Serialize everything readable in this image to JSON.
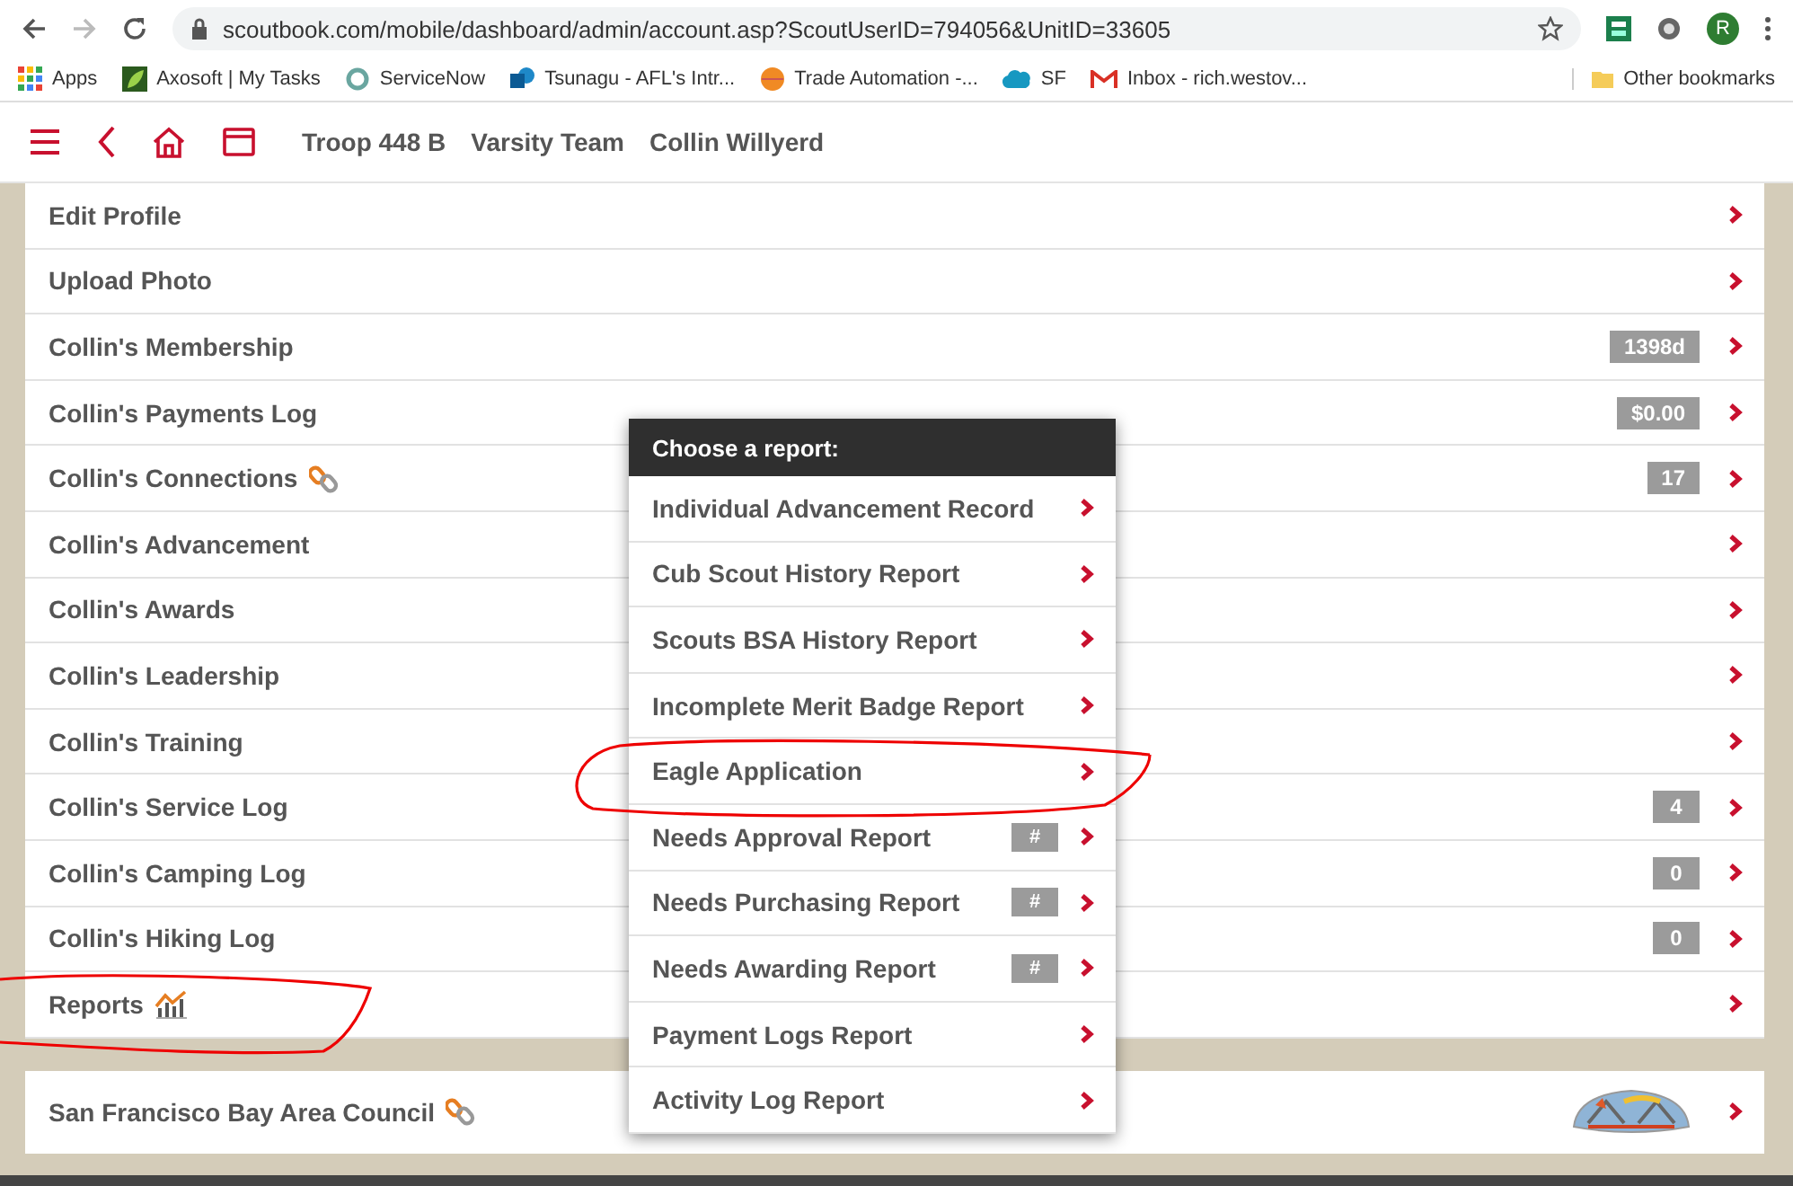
{
  "browser": {
    "url": "scoutbook.com/mobile/dashboard/admin/account.asp?ScoutUserID=794056&UnitID=33605",
    "profile_initial": "R",
    "bookmarks": [
      {
        "label": "Apps",
        "kind": "apps"
      },
      {
        "label": "Axosoft | My Tasks",
        "kind": "leaf"
      },
      {
        "label": "ServiceNow",
        "kind": "ring"
      },
      {
        "label": "Tsunagu - AFL's Intr...",
        "kind": "share"
      },
      {
        "label": "Trade Automation -...",
        "kind": "ball"
      },
      {
        "label": "SF",
        "kind": "cloud"
      },
      {
        "label": "Inbox - rich.westov...",
        "kind": "mail"
      }
    ],
    "other_bookmarks": "Other bookmarks"
  },
  "header": {
    "crumbs": [
      "Troop 448 B",
      "Varsity Team",
      "Collin Willyerd"
    ]
  },
  "menu": [
    {
      "label": "Edit Profile",
      "kind": "plain"
    },
    {
      "label": "Upload Photo",
      "kind": "plain"
    },
    {
      "label": "Collin's Membership",
      "kind": "plain",
      "badge": "1398d"
    },
    {
      "label": "Collin's Payments Log",
      "kind": "plain",
      "badge": "$0.00"
    },
    {
      "label": "Collin's Connections",
      "kind": "link",
      "badge": "17"
    },
    {
      "label": "Collin's Advancement",
      "kind": "plain"
    },
    {
      "label": "Collin's Awards",
      "kind": "plain"
    },
    {
      "label": "Collin's Leadership",
      "kind": "plain"
    },
    {
      "label": "Collin's Training",
      "kind": "plain"
    },
    {
      "label": "Collin's Service Log",
      "kind": "plain",
      "badge": "4"
    },
    {
      "label": "Collin's Camping Log",
      "kind": "plain",
      "badge": "0"
    },
    {
      "label": "Collin's Hiking Log",
      "kind": "plain",
      "badge": "0"
    },
    {
      "label": "Reports",
      "kind": "chart"
    }
  ],
  "council": {
    "label": "San Francisco Bay Area Council",
    "kind": "link"
  },
  "popup": {
    "title": "Choose a report:",
    "items": [
      {
        "label": "Individual Advancement Record"
      },
      {
        "label": "Cub Scout History Report"
      },
      {
        "label": "Scouts BSA History Report"
      },
      {
        "label": "Incomplete Merit Badge Report"
      },
      {
        "label": "Eagle Application"
      },
      {
        "label": "Needs Approval Report",
        "badge": "#"
      },
      {
        "label": "Needs Purchasing Report",
        "badge": "#"
      },
      {
        "label": "Needs Awarding Report",
        "badge": "#"
      },
      {
        "label": "Payment Logs Report"
      },
      {
        "label": "Activity Log Report"
      }
    ]
  }
}
